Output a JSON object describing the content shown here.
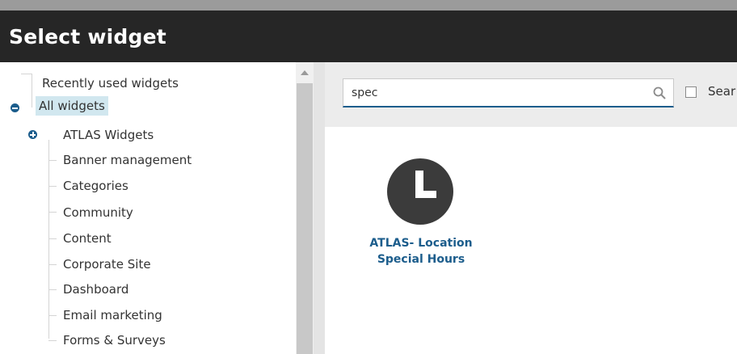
{
  "dialog": {
    "title": "Select widget"
  },
  "tree": {
    "root_items": [
      {
        "label": "Recently used widgets"
      },
      {
        "label": "All widgets",
        "selected": true,
        "expanded": true
      }
    ],
    "children": [
      {
        "label": "ATLAS Widgets",
        "has_children": true,
        "expanded": false
      },
      {
        "label": "Banner management"
      },
      {
        "label": "Categories"
      },
      {
        "label": "Community"
      },
      {
        "label": "Content"
      },
      {
        "label": "Corporate Site"
      },
      {
        "label": "Dashboard"
      },
      {
        "label": "Email marketing"
      },
      {
        "label": "Forms & Surveys"
      }
    ]
  },
  "search": {
    "value": "spec",
    "option_label": "Sear"
  },
  "results": [
    {
      "title_line1": "ATLAS- Location",
      "title_line2": "Special Hours",
      "icon": "clock-icon"
    }
  ],
  "colors": {
    "header_bg": "#262626",
    "accent": "#1c5d8c",
    "selected_bg": "#d1e7ef"
  }
}
